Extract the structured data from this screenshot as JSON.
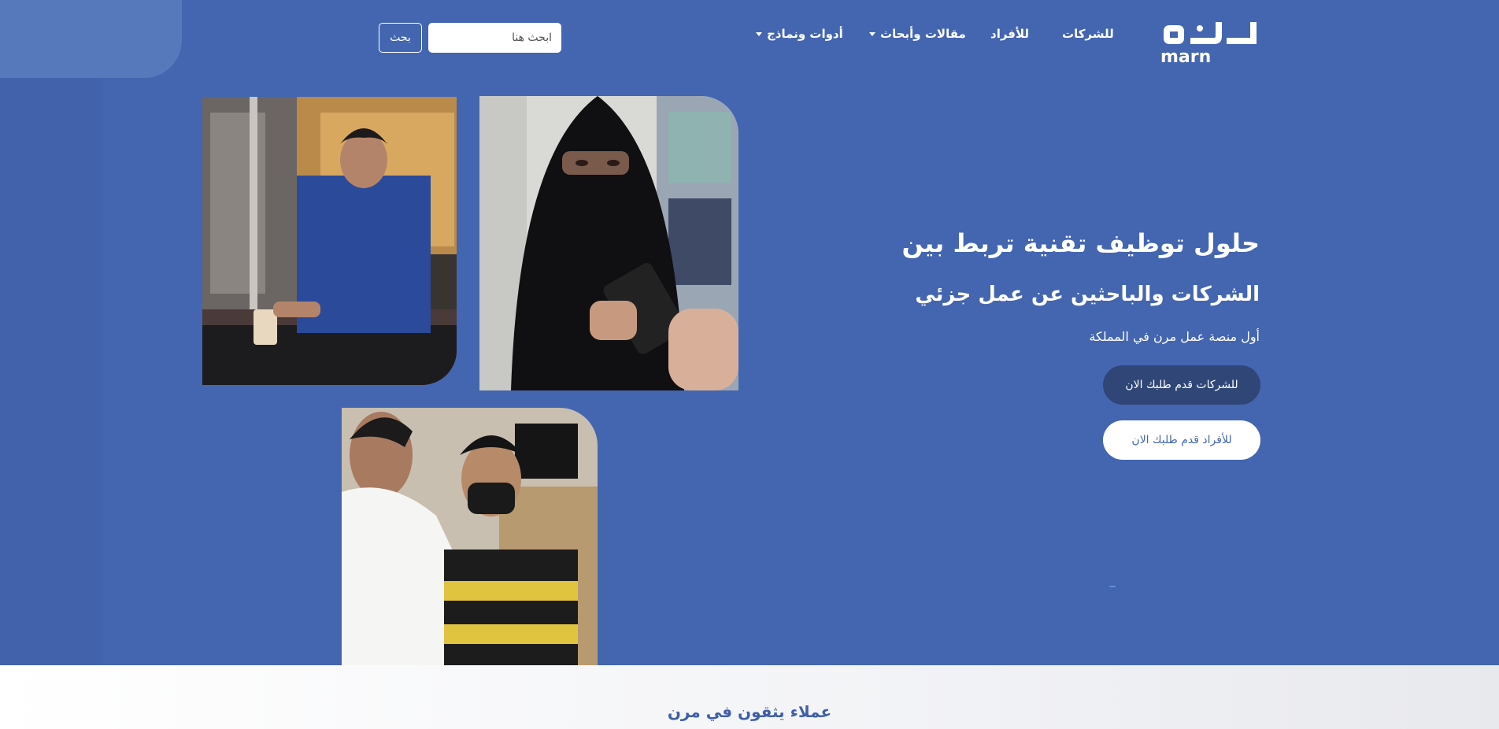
{
  "header": {
    "logo_icon": "marn-logo-icon",
    "logo_text": "marn",
    "nav": [
      {
        "label": "للشركات"
      },
      {
        "label": "للأفراد"
      },
      {
        "label": "مقالات وأبحاث"
      },
      {
        "label": "أدوات ونماذج"
      }
    ],
    "search": {
      "placeholder": "ابحث هنا",
      "button_label": "بحث"
    }
  },
  "hero": {
    "title_line1": "حلول توظيف تقنية تربط بين",
    "title_line2": "الشركات والباحثين عن عمل جزئي",
    "subtitle": "أول منصة عمل مرن في المملكة",
    "cta_companies": "للشركات قدم طلبك الان",
    "cta_individuals": "للأفراد قدم طلبك الان"
  },
  "clients": {
    "title": "عملاء يثقون في مرن"
  },
  "colors": {
    "primary": "#4466b0",
    "dark_button": "#2f4677",
    "corner_shape": "#5679bb",
    "section_bg": "#f2f3f6"
  }
}
